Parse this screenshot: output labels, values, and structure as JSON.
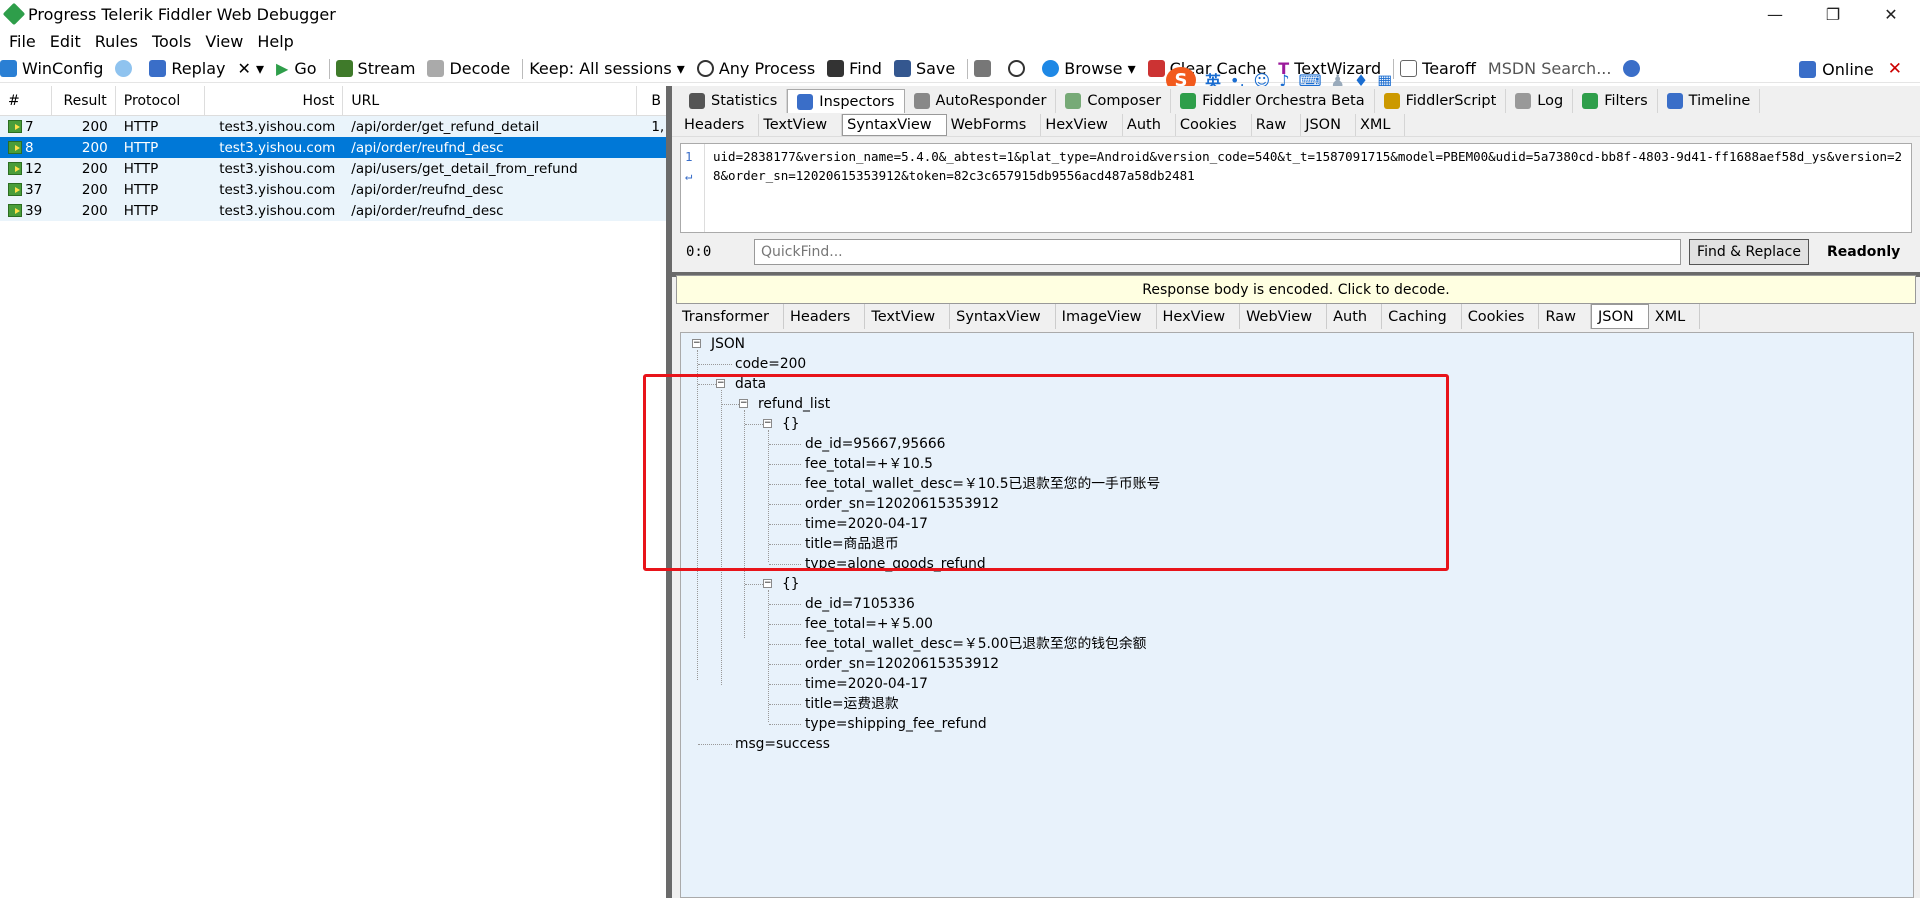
{
  "window": {
    "title": "Progress Telerik Fiddler Web Debugger",
    "min": "—",
    "max": "❐",
    "close": "✕"
  },
  "menu": [
    "File",
    "Edit",
    "Rules",
    "Tools",
    "View",
    "Help"
  ],
  "toolbar": {
    "winconfig": "WinConfig",
    "replay": "Replay",
    "remove": "✕ ▾",
    "go": "Go",
    "stream": "Stream",
    "decode": "Decode",
    "keep": "Keep: All sessions ▾",
    "process": "Any Process",
    "find": "Find",
    "save": "Save",
    "browse": "Browse ▾",
    "clear_cache": "Clear Cache",
    "textwizard": "TextWizard",
    "tearoff": "Tearoff",
    "msdn": "MSDN Search...",
    "online": "Online",
    "close_x": "✕"
  },
  "ime": {
    "logo": "S",
    "lang": "英"
  },
  "sessions": {
    "columns": [
      "#",
      "Result",
      "Protocol",
      "Host",
      "URL",
      "B"
    ],
    "rows": [
      {
        "id": "7",
        "result": "200",
        "protocol": "HTTP",
        "host": "test3.yishou.com",
        "url": "/api/order/get_refund_detail",
        "body": "1,",
        "selected": false
      },
      {
        "id": "8",
        "result": "200",
        "protocol": "HTTP",
        "host": "test3.yishou.com",
        "url": "/api/order/reufnd_desc",
        "body": "",
        "selected": true
      },
      {
        "id": "12",
        "result": "200",
        "protocol": "HTTP",
        "host": "test3.yishou.com",
        "url": "/api/users/get_detail_from_refund",
        "body": "",
        "selected": false
      },
      {
        "id": "37",
        "result": "200",
        "protocol": "HTTP",
        "host": "test3.yishou.com",
        "url": "/api/order/reufnd_desc",
        "body": "",
        "selected": false
      },
      {
        "id": "39",
        "result": "200",
        "protocol": "HTTP",
        "host": "test3.yishou.com",
        "url": "/api/order/reufnd_desc",
        "body": "",
        "selected": false
      }
    ]
  },
  "top_tabs": [
    {
      "label": "Statistics",
      "color": "#555"
    },
    {
      "label": "Inspectors",
      "color": "#3a6ec8",
      "active": true
    },
    {
      "label": "AutoResponder",
      "color": "#888"
    },
    {
      "label": "Composer",
      "color": "#7a7"
    },
    {
      "label": "Fiddler Orchestra Beta",
      "color": "#2e9e4a"
    },
    {
      "label": "FiddlerScript",
      "color": "#c90"
    },
    {
      "label": "Log",
      "color": "#999"
    },
    {
      "label": "Filters",
      "color": "#2e9e4a"
    },
    {
      "label": "Timeline",
      "color": "#3a6ec8"
    }
  ],
  "request_tabs": [
    "Headers",
    "TextView",
    "SyntaxView",
    "WebForms",
    "HexView",
    "Auth",
    "Cookies",
    "Raw",
    "JSON",
    "XML"
  ],
  "request_active": "SyntaxView",
  "request_body": {
    "line1": "1",
    "wrap": "↵",
    "text": "uid=2838177&version_name=5.4.0&_abtest=1&plat_type=Android&version_code=540&t_t=1587091715&model=PBEM00&udid=5a7380cd-bb8f-4803-9d41-ff1688aef58d_ys&version=28&order_sn=12020615353912&token=82c3c657915db9556acd487a58db2481"
  },
  "quickfind": {
    "position": "0:0",
    "placeholder": "QuickFind...",
    "button": "Find & Replace",
    "readonly": "Readonly"
  },
  "notice": "Response body is encoded. Click to decode.",
  "response_tabs": [
    "Transformer",
    "Headers",
    "TextView",
    "SyntaxView",
    "ImageView",
    "HexView",
    "WebView",
    "Auth",
    "Caching",
    "Cookies",
    "Raw",
    "JSON",
    "XML"
  ],
  "response_active": "JSON",
  "tree": {
    "root": "JSON",
    "code": "code=200",
    "data": "data",
    "refund_list": "refund_list",
    "obj1": "{}",
    "item1": [
      "de_id=95667,95666",
      "fee_total=+￥10.5",
      "fee_total_wallet_desc=￥10.5已退款至您的一手币账号",
      "order_sn=12020615353912",
      "time=2020-04-17",
      "title=商品退币",
      "type=alone_goods_refund"
    ],
    "obj2": "{}",
    "item2": [
      "de_id=7105336",
      "fee_total=+￥5.00",
      "fee_total_wallet_desc=￥5.00已退款至您的钱包余额",
      "order_sn=12020615353912",
      "time=2020-04-17",
      "title=运费退款",
      "type=shipping_fee_refund"
    ],
    "msg": "msg=success"
  }
}
